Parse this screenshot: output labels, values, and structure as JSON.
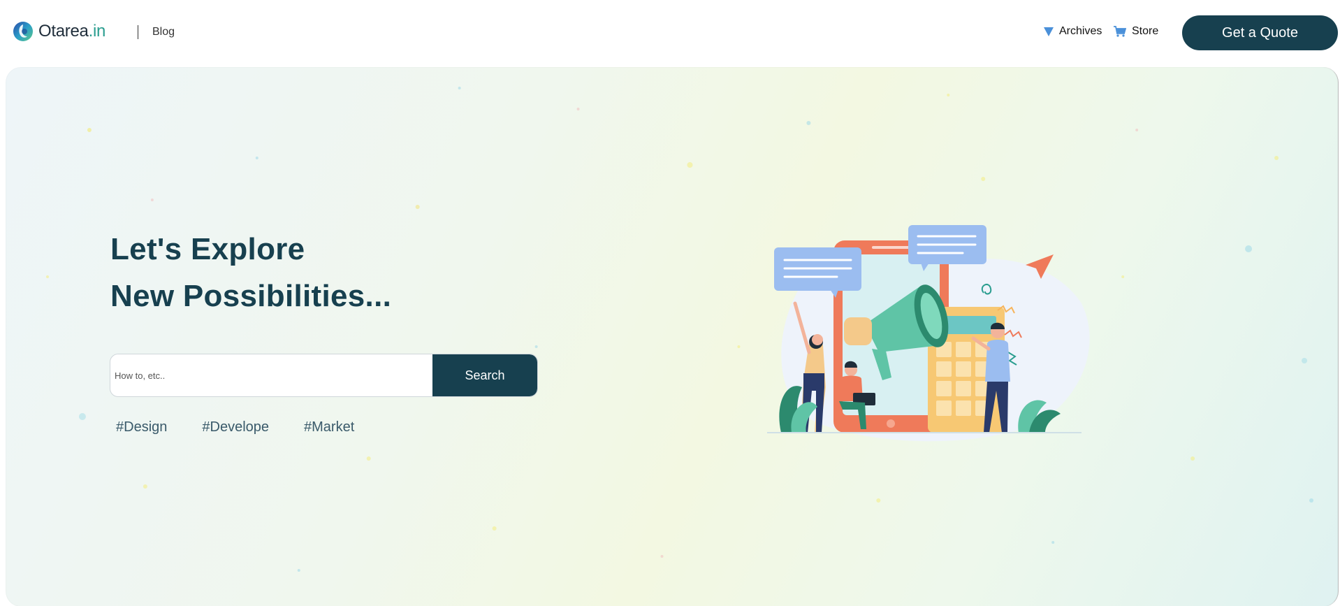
{
  "header": {
    "logo": {
      "name": "Otarea",
      "suffix": ".in",
      "icon": "otarea-logo-icon"
    },
    "blog_label": "Blog",
    "nav": [
      {
        "label": "Archives",
        "icon": "triangle-down-icon"
      },
      {
        "label": "Store",
        "icon": "cart-icon"
      }
    ],
    "cta_label": "Get a Quote"
  },
  "hero": {
    "title_line1": "Let's Explore",
    "title_line2": "New Possibilities...",
    "search": {
      "placeholder": "How to, etc..",
      "value": "",
      "button_label": "Search"
    },
    "tags": [
      "#Design",
      "#Develope",
      "#Market"
    ],
    "illustration": "marketing-megaphone-illustration"
  },
  "colors": {
    "primary": "#17404f",
    "accent": "#2a9d8f",
    "icon_blue": "#4a90d9"
  }
}
